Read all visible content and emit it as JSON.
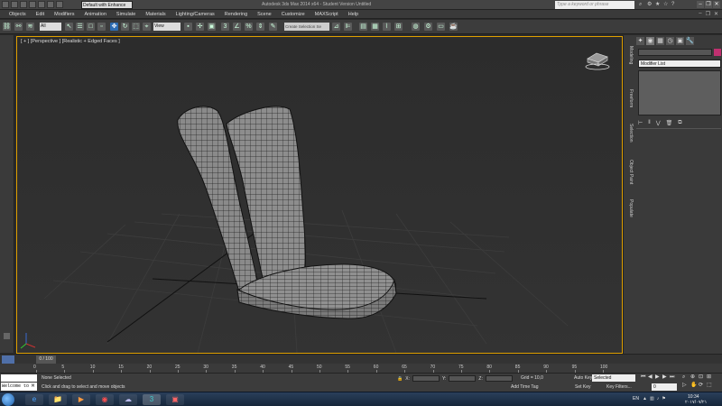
{
  "titlebar": {
    "workspace": "Default with Enhance",
    "title": "Autodesk 3ds Max 2014 x64 - Student Version   Untitled",
    "search_placeholder": "Type a keyword or phrase",
    "window_controls": [
      "–",
      "❐",
      "✕"
    ]
  },
  "menubar": {
    "items": [
      "Objects",
      "Edit",
      "Modifiers",
      "Animation",
      "Simulate",
      "Materials",
      "Lighting/Cameras",
      "Rendering",
      "Scene",
      "Customize",
      "MAXScript",
      "Help"
    ]
  },
  "toolbar": {
    "selection_filter": "All",
    "reference_coord": "View",
    "named_selection": "Create Selection Se"
  },
  "viewport": {
    "label": "[ + ] [Perspective ] [Realistic + Edged Faces ]"
  },
  "command_panel": {
    "tabs": [
      "✦",
      "◉",
      "▦",
      "◷",
      "▣",
      "🔧"
    ],
    "vertical_tabs": [
      "Modeling",
      "Freeform",
      "Selection",
      "Object Paint",
      "Populate"
    ],
    "modifier_list": "Modifier List",
    "stack_tools": [
      "⊢",
      "‖",
      "⋁",
      "🗑",
      "⧉"
    ]
  },
  "timeline": {
    "frame_display": "0 / 100",
    "ticks": [
      "0",
      "5",
      "10",
      "15",
      "20",
      "25",
      "30",
      "35",
      "40",
      "45",
      "50",
      "55",
      "60",
      "65",
      "70",
      "75",
      "80",
      "85",
      "90",
      "95",
      "100"
    ]
  },
  "statusbar": {
    "maxscript_listener": "Welcome to M",
    "selection": "None Selected",
    "prompt": "Click and drag to select and move objects",
    "x_label": "X:",
    "y_label": "Y:",
    "z_label": "Z:",
    "grid": "Grid = 10,0",
    "add_time_tag": "Add Time Tag",
    "auto_key": "Auto Key",
    "auto_key_mode": "Selected",
    "set_key": "Set Key",
    "key_filters": "Key Filters...",
    "current_frame": "0"
  },
  "taskbar": {
    "apps": [
      "e",
      "📁",
      "▶",
      "◉",
      "☁",
      "3",
      "▣"
    ],
    "language": "EN",
    "time": "10:34",
    "date": "۲۰۱۷/۰۷/۲۱"
  },
  "colors": {
    "viewport_border": "#e0a000",
    "object_color": "#c03070",
    "accent_blue": "#2d6cb2"
  }
}
